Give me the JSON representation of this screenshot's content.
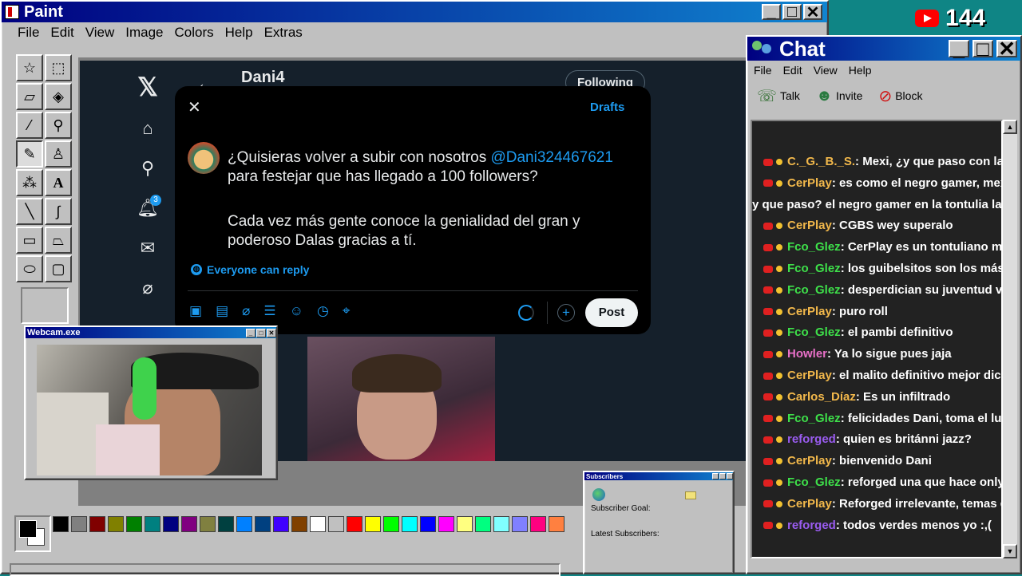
{
  "youtube": {
    "count": "144",
    "icon": "youtube-icon",
    "color": "#ff0000"
  },
  "paint": {
    "title": "Paint",
    "menu": [
      "File",
      "Edit",
      "View",
      "Image",
      "Colors",
      "Help",
      "Extras"
    ],
    "palette": [
      "#000000",
      "#808080",
      "#800000",
      "#808000",
      "#008000",
      "#008080",
      "#000080",
      "#800080",
      "#808040",
      "#004040",
      "#0080ff",
      "#004080",
      "#4000ff",
      "#804000",
      "#ffffff",
      "#c0c0c0",
      "#ff0000",
      "#ffff00",
      "#00ff00",
      "#00ffff",
      "#0000ff",
      "#ff00ff",
      "#ffff80",
      "#00ff80",
      "#80ffff",
      "#8080ff",
      "#ff0080",
      "#ff8040"
    ]
  },
  "x": {
    "profile_name": "Dani4",
    "following_label": "Following",
    "notif_count": "3",
    "compose": {
      "drafts_label": "Drafts",
      "text_line1": "¿Quisieras volver a subir con nosotros ",
      "mention": "@Dani324467621",
      "text_line2": "para festejar que has llegado a 100 followers?",
      "text_line3": "Cada vez más gente conoce la genialidad del gran y",
      "text_line4": "poderoso Dalas gracias a tí.",
      "reply_setting": "Everyone can reply",
      "post_label": "Post"
    },
    "accent": "#1d9bf0"
  },
  "webcam": {
    "title": "Webcam.exe"
  },
  "chat": {
    "title": "Chat",
    "menu": [
      "File",
      "Edit",
      "View",
      "Help"
    ],
    "toolbar": {
      "talk": "Talk",
      "invite": "Invite",
      "block": "Block"
    },
    "messages": [
      {
        "user": "C._G._B._S.",
        "text": ": Mexi, ¿y que paso con la Britanni J",
        "color": "#f2b84b"
      },
      {
        "user": "CerPlay",
        "text": ": es como el negro gamer, mexi dijo y",
        "color": "#f2b84b"
      },
      {
        "user": "",
        "text": "y que paso? el negro gamer en la tontulia la sigue",
        "color": "#ffffff"
      },
      {
        "user": "CerPlay",
        "text": ": CGBS wey superalo",
        "color": "#f2b84b"
      },
      {
        "user": "Fco_Glez",
        "text": ": CerPlay es un tontuliano muy prob",
        "color": "#3ee04a"
      },
      {
        "user": "Fco_Glez",
        "text": ": los guibelsitos son los más misóg",
        "color": "#3ee04a"
      },
      {
        "user": "Fco_Glez",
        "text": ": desperdician su juventud viendo a",
        "color": "#3ee04a"
      },
      {
        "user": "CerPlay",
        "text": ": puro roll",
        "color": "#f2b84b"
      },
      {
        "user": "Fco_Glez",
        "text": ": el pambi definitivo",
        "color": "#3ee04a"
      },
      {
        "user": "Howler",
        "text": ": Ya lo sigue pues jaja",
        "color": "#e870c8"
      },
      {
        "user": "CerPlay",
        "text": ": el malito definitivo mejor dicho esta",
        "color": "#f2b84b"
      },
      {
        "user": "Carlos_Díaz",
        "text": ": Es un infiltrado",
        "color": "#f2b84b"
      },
      {
        "user": "Fco_Glez",
        "text": ": felicidades Dani, toma el lugar de",
        "color": "#3ee04a"
      },
      {
        "user": "reforged",
        "text": ": quien es británni jazz?",
        "color": "#9a5cf0"
      },
      {
        "user": "CerPlay",
        "text": ": bienvenido Dani",
        "color": "#f2b84b"
      },
      {
        "user": "Fco_Glez",
        "text": ": reforged una que hace only fans",
        "color": "#3ee04a"
      },
      {
        "user": "CerPlay",
        "text": ": Reforged irrelevante, temas de hac",
        "color": "#f2b84b"
      },
      {
        "user": "reforged",
        "text": ": todos verdes menos yo :,(",
        "color": "#9a5cf0"
      }
    ]
  },
  "subscribers": {
    "title": "Subscribers",
    "goal_label": "Subscriber Goal:",
    "latest_label": "Latest Subscribers:"
  }
}
